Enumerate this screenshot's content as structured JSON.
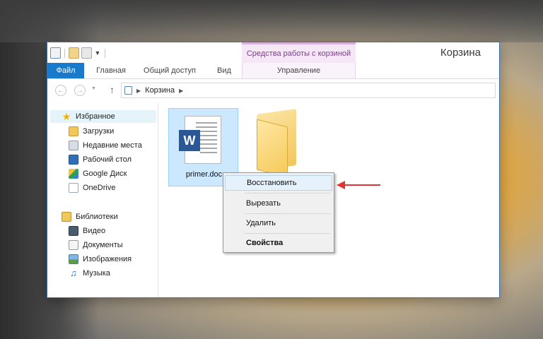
{
  "window": {
    "title": "Корзина",
    "contextual_group": "Средства работы с корзиной"
  },
  "ribbon": {
    "tabs": [
      {
        "label": "Файл"
      },
      {
        "label": "Главная"
      },
      {
        "label": "Общий доступ"
      },
      {
        "label": "Вид"
      },
      {
        "label": "Управление"
      }
    ]
  },
  "address": {
    "path": "Корзина"
  },
  "nav": {
    "favorites_label": "Избранное",
    "favorites": [
      {
        "label": "Загрузки",
        "icon": "downloads-icon"
      },
      {
        "label": "Недавние места",
        "icon": "recent-places-icon"
      },
      {
        "label": "Рабочий стол",
        "icon": "desktop-icon"
      },
      {
        "label": "Google Диск",
        "icon": "google-drive-icon"
      },
      {
        "label": "OneDrive",
        "icon": "onedrive-icon"
      }
    ],
    "libraries_label": "Библиотеки",
    "libraries": [
      {
        "label": "Видео",
        "icon": "video-icon"
      },
      {
        "label": "Документы",
        "icon": "documents-icon"
      },
      {
        "label": "Изображения",
        "icon": "pictures-icon"
      },
      {
        "label": "Музыка",
        "icon": "music-icon"
      }
    ]
  },
  "files": [
    {
      "name": "primer.docx",
      "display": "primer.doc",
      "icon": "word-document-icon",
      "selected": true
    },
    {
      "name": "",
      "icon": "folder-icon",
      "selected": false
    }
  ],
  "context_menu": {
    "items": [
      {
        "label": "Восстановить",
        "highlighted": true
      },
      {
        "label": "Вырезать"
      },
      {
        "label": "Удалить"
      },
      {
        "label": "Свойства",
        "bold": true
      }
    ]
  },
  "colors": {
    "file_tab": "#1979ca",
    "contextual_tab": "#f5e7f6",
    "selection": "#cce8ff",
    "annotation_arrow": "#e53333",
    "background": "#f6b92a"
  }
}
